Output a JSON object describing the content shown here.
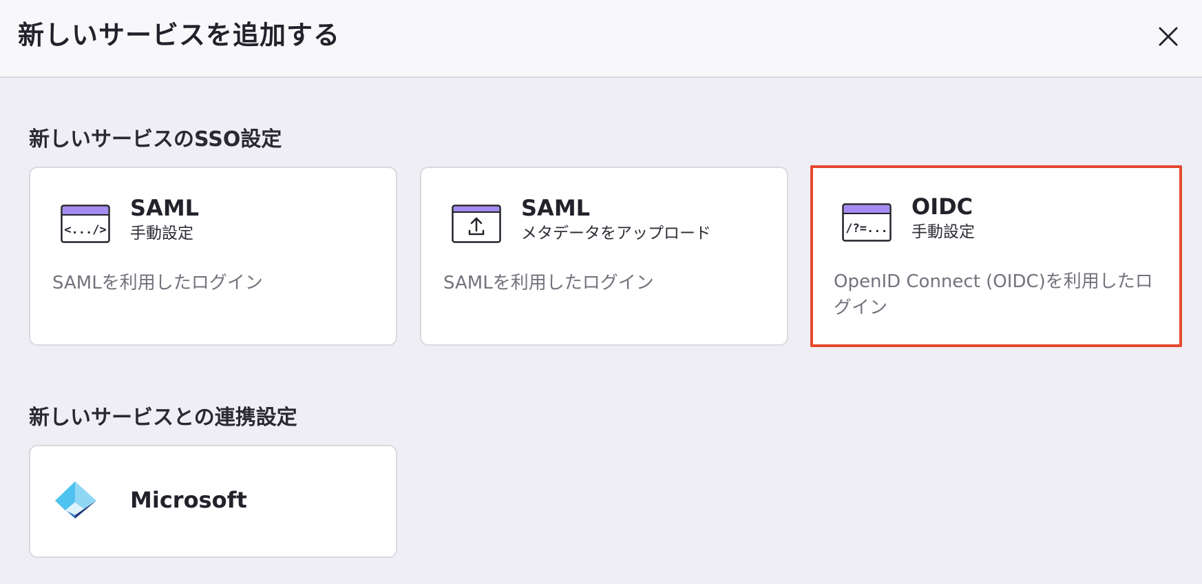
{
  "dialog": {
    "title": "新しいサービスを追加する",
    "close_icon": "close-icon"
  },
  "sso_section": {
    "heading": "新しいサービスのSSO設定",
    "cards": [
      {
        "title": "SAML",
        "subtitle": "手動設定",
        "description": "SAMLを利用したログイン",
        "icon": "code-window-icon",
        "icon_text": "<.../>"
      },
      {
        "title": "SAML",
        "subtitle": "メタデータをアップロード",
        "description": "SAMLを利用したログイン",
        "icon": "upload-window-icon"
      },
      {
        "title": "OIDC",
        "subtitle": "手動設定",
        "description": "OpenID Connect (OIDC)を利用したログイン",
        "icon": "query-window-icon",
        "icon_text": "/?=...",
        "highlighted": true
      }
    ]
  },
  "integration_section": {
    "heading": "新しいサービスとの連携設定",
    "cards": [
      {
        "title": "Microsoft",
        "icon": "microsoft-entra-icon"
      }
    ]
  },
  "colors": {
    "accent_purple": "#a58bf2",
    "highlight_border": "#e5482e",
    "background": "#efeef4",
    "muted_text": "#73727c"
  }
}
